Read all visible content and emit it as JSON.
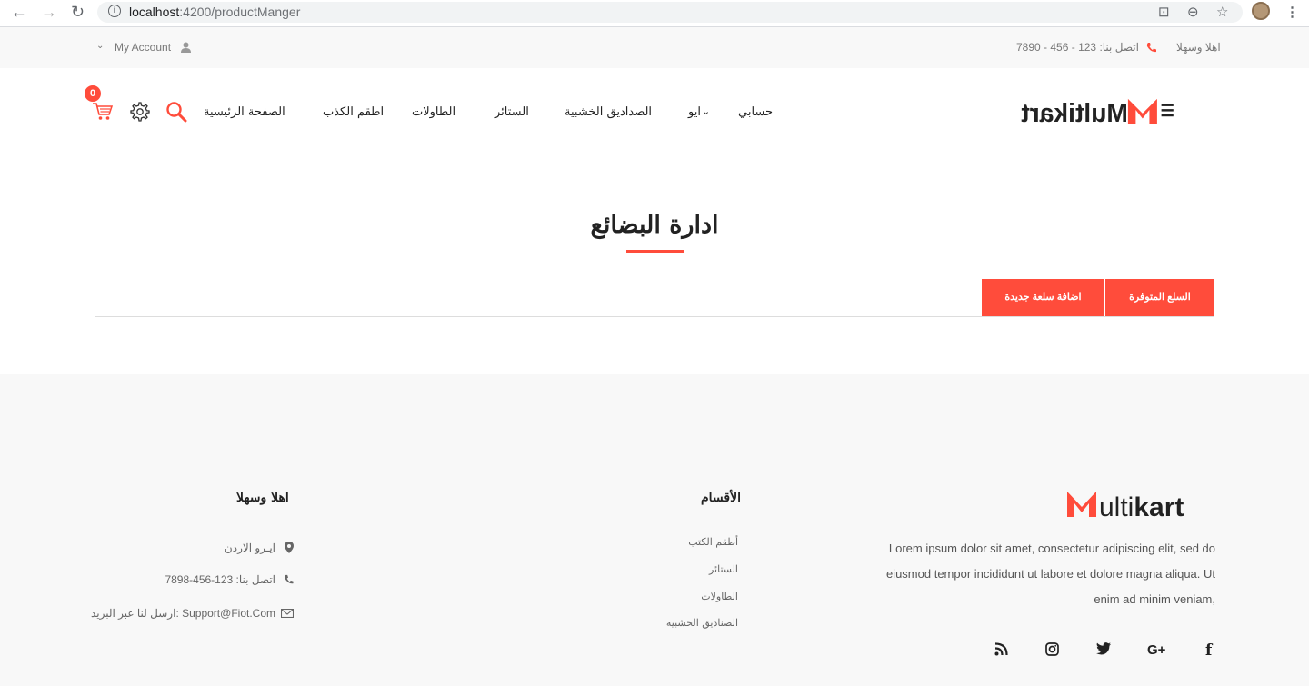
{
  "browser": {
    "url_host": "localhost",
    "url_path": ":4200/productManger"
  },
  "topbar": {
    "welcome": "اهلا وسهلا",
    "phone": "اتصل بنا: 123 - 456 - 7890",
    "account": "My Account"
  },
  "logo": {
    "text": "Multikart"
  },
  "menu": {
    "items": [
      "حسابي",
      "ايو",
      "الصداديق الخشبية",
      "الستائر",
      "الطاولات",
      "اطقم الكذب",
      "الصفحة الرئيسية"
    ]
  },
  "cart": {
    "count": "0"
  },
  "page": {
    "title": "ادارة البضائع"
  },
  "tabs": {
    "available": "السلع المتوفرة",
    "add_new": "اضافة سلعة جديدة"
  },
  "footer": {
    "about": "Lorem ipsum dolor sit amet, consectetur adipiscing elit, sed do eiusmod tempor incididunt ut labore et dolore magna aliqua. Ut enim ad minim veniam,",
    "categories_title": "الأقسام",
    "categories": [
      "أطقم الكتب",
      "الستائر",
      "الطاولات",
      "الصناديق الخشبية"
    ],
    "contact_title": "اهلا وسهلا",
    "address": "ايـرو الاردن",
    "phone": "اتصل بنا: 123-456-7898",
    "email": "ارسل لنا عبر البريد: Support@Fiot.Com"
  },
  "colors": {
    "accent": "#ff4c3b"
  }
}
